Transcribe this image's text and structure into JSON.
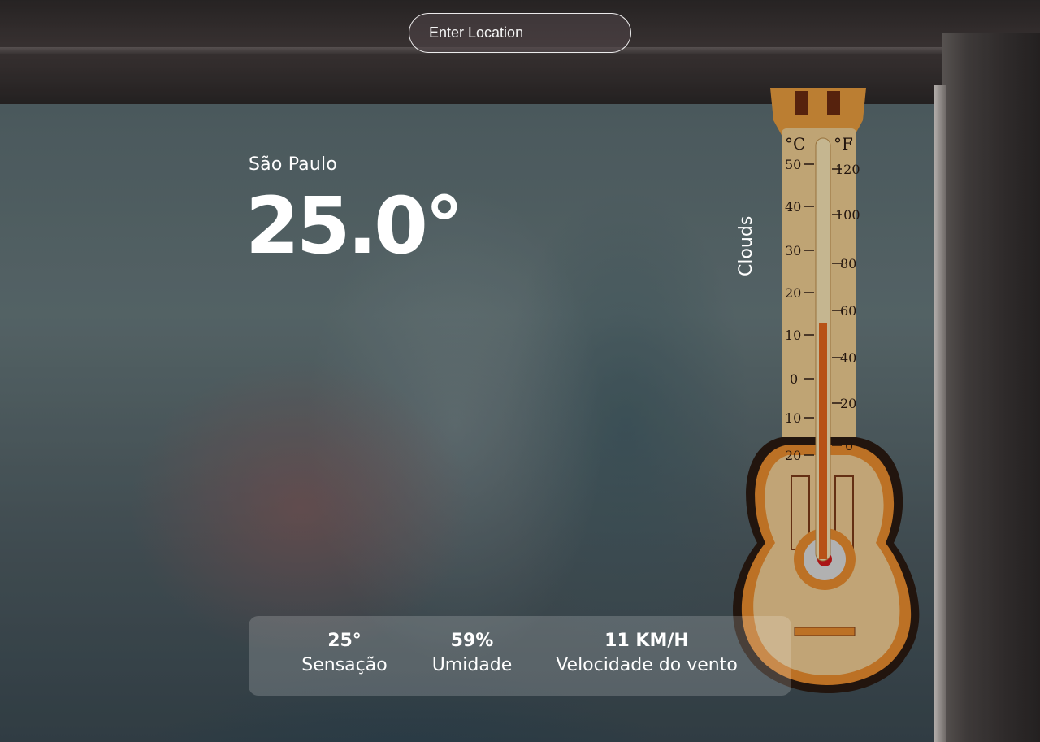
{
  "search": {
    "placeholder": "Enter Location"
  },
  "weather": {
    "city": "São Paulo",
    "temperature": "25.0°",
    "description": "Clouds"
  },
  "stats": {
    "feels_like": {
      "value": "25°",
      "label": "Sensação"
    },
    "humidity": {
      "value": "59%",
      "label": "Umidade"
    },
    "wind": {
      "value": "11 KM/H",
      "label": "Velocidade do vento"
    }
  },
  "colors": {
    "text": "#ffffff",
    "panel": "rgba(255,255,255,0.18)",
    "search_border": "#ffffff"
  }
}
